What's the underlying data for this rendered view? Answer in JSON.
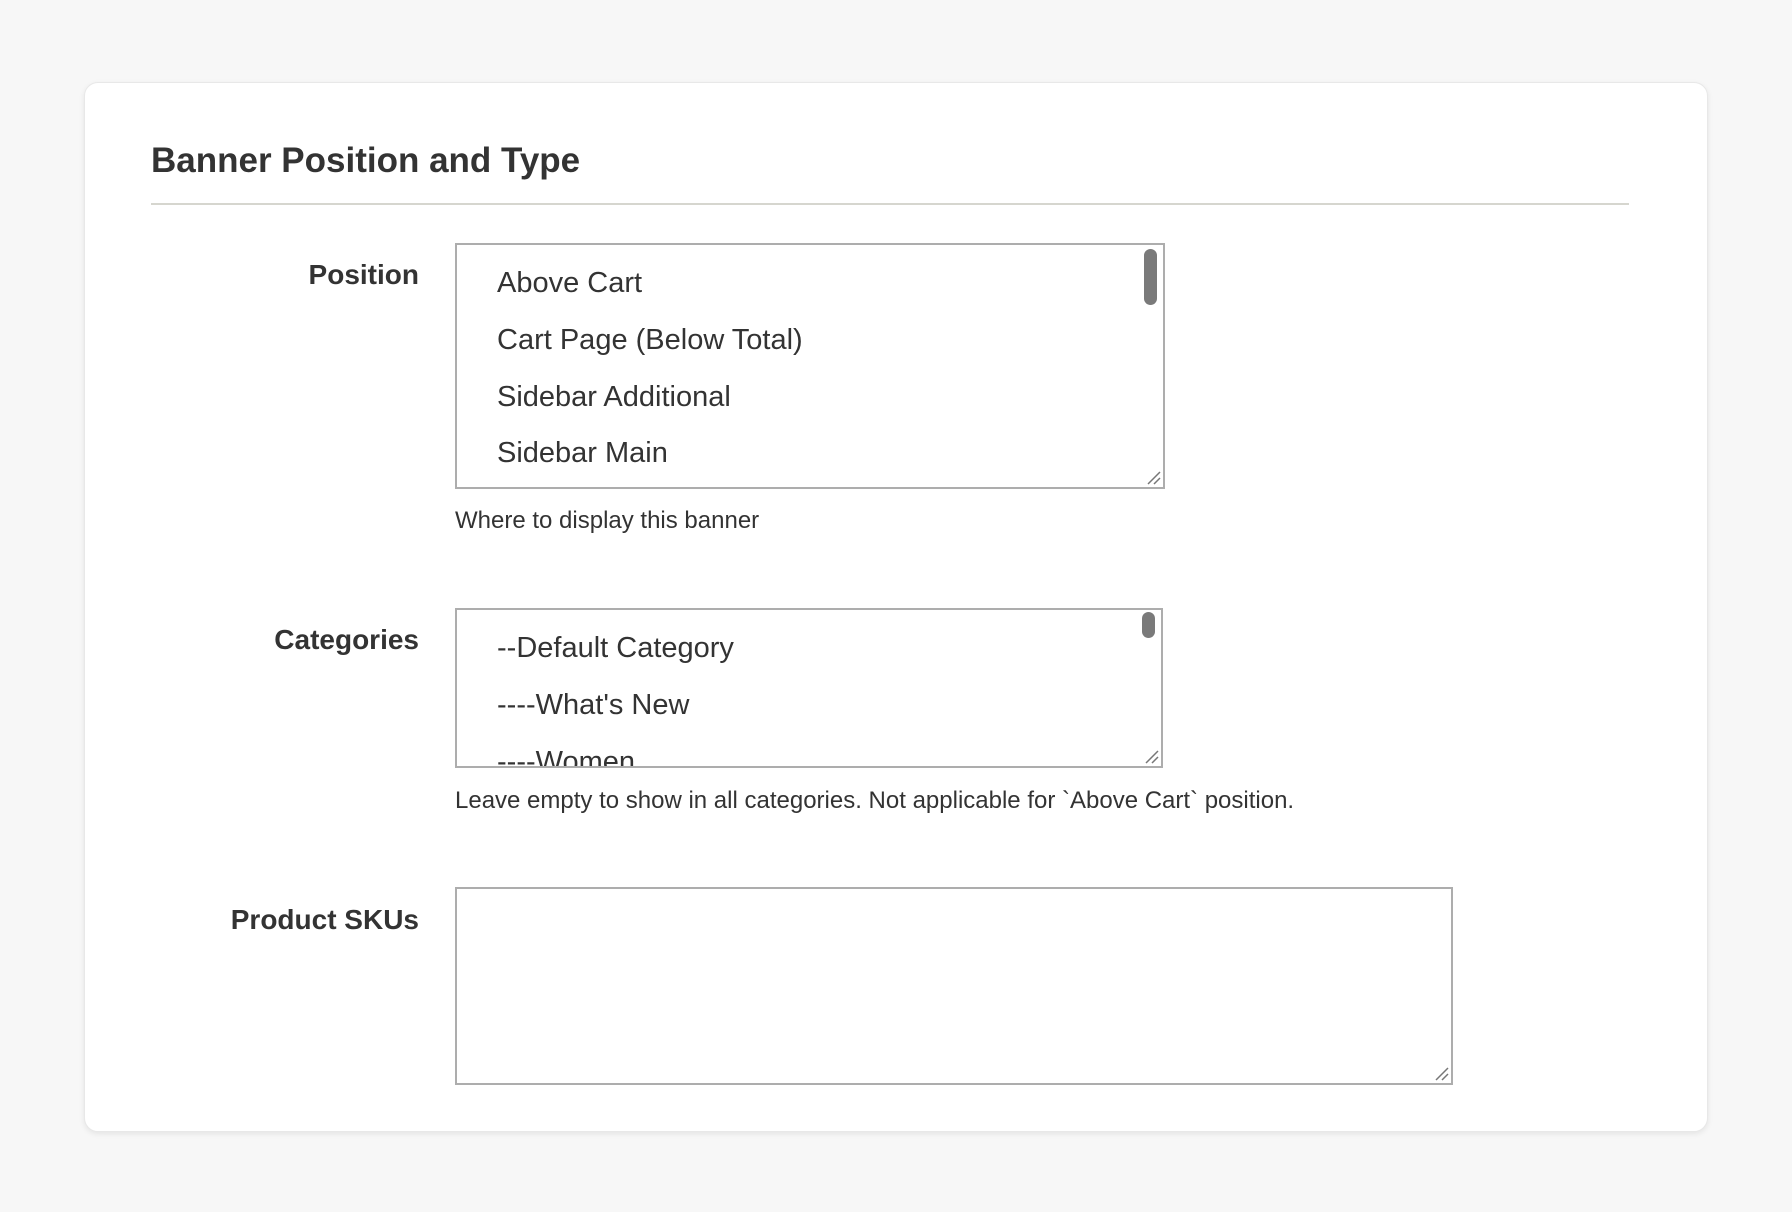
{
  "section": {
    "title": "Banner Position and Type"
  },
  "position": {
    "label": "Position",
    "options": [
      "Above Cart",
      "Cart Page (Below Total)",
      "Sidebar Additional",
      "Sidebar Main"
    ],
    "hint": "Where to display this banner"
  },
  "categories": {
    "label": "Categories",
    "options": [
      "--Default Category",
      "----What's New",
      "----Women"
    ],
    "hint": "Leave empty to show in all categories. Not applicable for `Above Cart` position."
  },
  "product_skus": {
    "label": "Product SKUs",
    "value": ""
  },
  "colors": {
    "page_background": "#f7f7f7",
    "card_background": "#ffffff",
    "text": "#333333",
    "border": "#adadad",
    "divider": "#d6d6cf"
  }
}
